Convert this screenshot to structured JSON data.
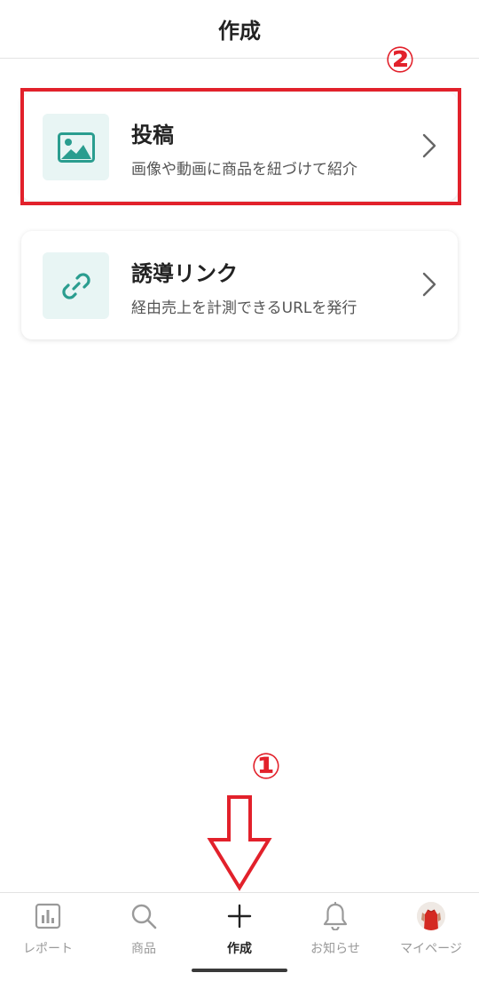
{
  "header": {
    "title": "作成"
  },
  "menu": {
    "post": {
      "title": "投稿",
      "description": "画像や動画に商品を紐づけて紹介",
      "icon": "image-icon"
    },
    "link": {
      "title": "誘導リンク",
      "description": "経由売上を計測できるURLを発行",
      "icon": "link-icon"
    }
  },
  "annotations": {
    "step1": "①",
    "step2": "②",
    "color": "#e2212b"
  },
  "tabbar": {
    "items": [
      {
        "label": "レポート",
        "icon": "bar-chart-icon",
        "active": false
      },
      {
        "label": "商品",
        "icon": "search-icon",
        "active": false
      },
      {
        "label": "作成",
        "icon": "plus-icon",
        "active": true
      },
      {
        "label": "お知らせ",
        "icon": "bell-icon",
        "active": false
      },
      {
        "label": "マイページ",
        "icon": "avatar",
        "active": false
      }
    ]
  },
  "colors": {
    "accent_teal": "#2a9d8f",
    "icon_bg": "#e8f5f4"
  }
}
